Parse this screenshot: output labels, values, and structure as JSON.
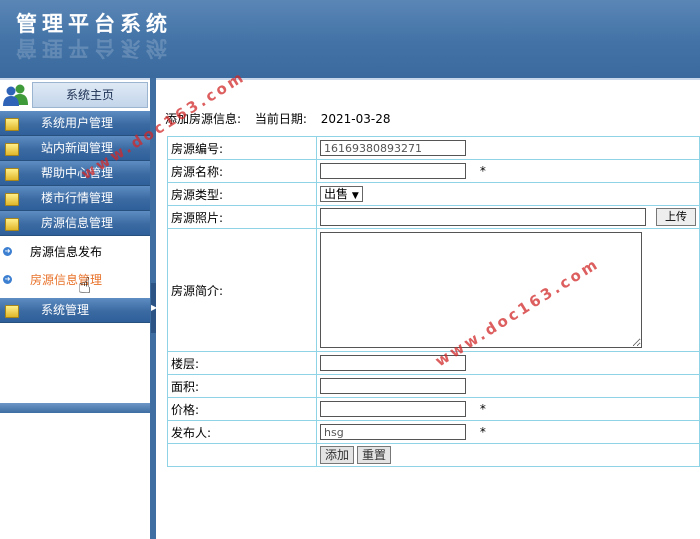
{
  "header": {
    "app_title": "管理平台系统"
  },
  "sidebar": {
    "home_label": "系统主页",
    "menu": [
      {
        "label": "系统用户管理"
      },
      {
        "label": "站内新闻管理"
      },
      {
        "label": "帮助中心管理"
      },
      {
        "label": "楼市行情管理"
      },
      {
        "label": "房源信息管理"
      }
    ],
    "submenu": [
      {
        "label": "房源信息发布",
        "active": false
      },
      {
        "label": "房源信息管理",
        "active": true
      }
    ],
    "system_label": "系统管理"
  },
  "page": {
    "heading": "添加房源信息:",
    "date_label": "当前日期:",
    "date_value": "2021-03-28"
  },
  "form": {
    "id_label": "房源编号:",
    "id_value": "16169380893271",
    "name_label": "房源名称:",
    "type_label": "房源类型:",
    "type_value": "出售",
    "photo_label": "房源照片:",
    "upload_label": "上传",
    "intro_label": "房源简介:",
    "floor_label": "楼层:",
    "area_label": "面积:",
    "price_label": "价格:",
    "publisher_label": "发布人:",
    "publisher_value": "hsg",
    "required_mark": "*",
    "add_button": "添加",
    "reset_button": "重置"
  },
  "watermark": {
    "text": "www.doc163.com"
  }
}
